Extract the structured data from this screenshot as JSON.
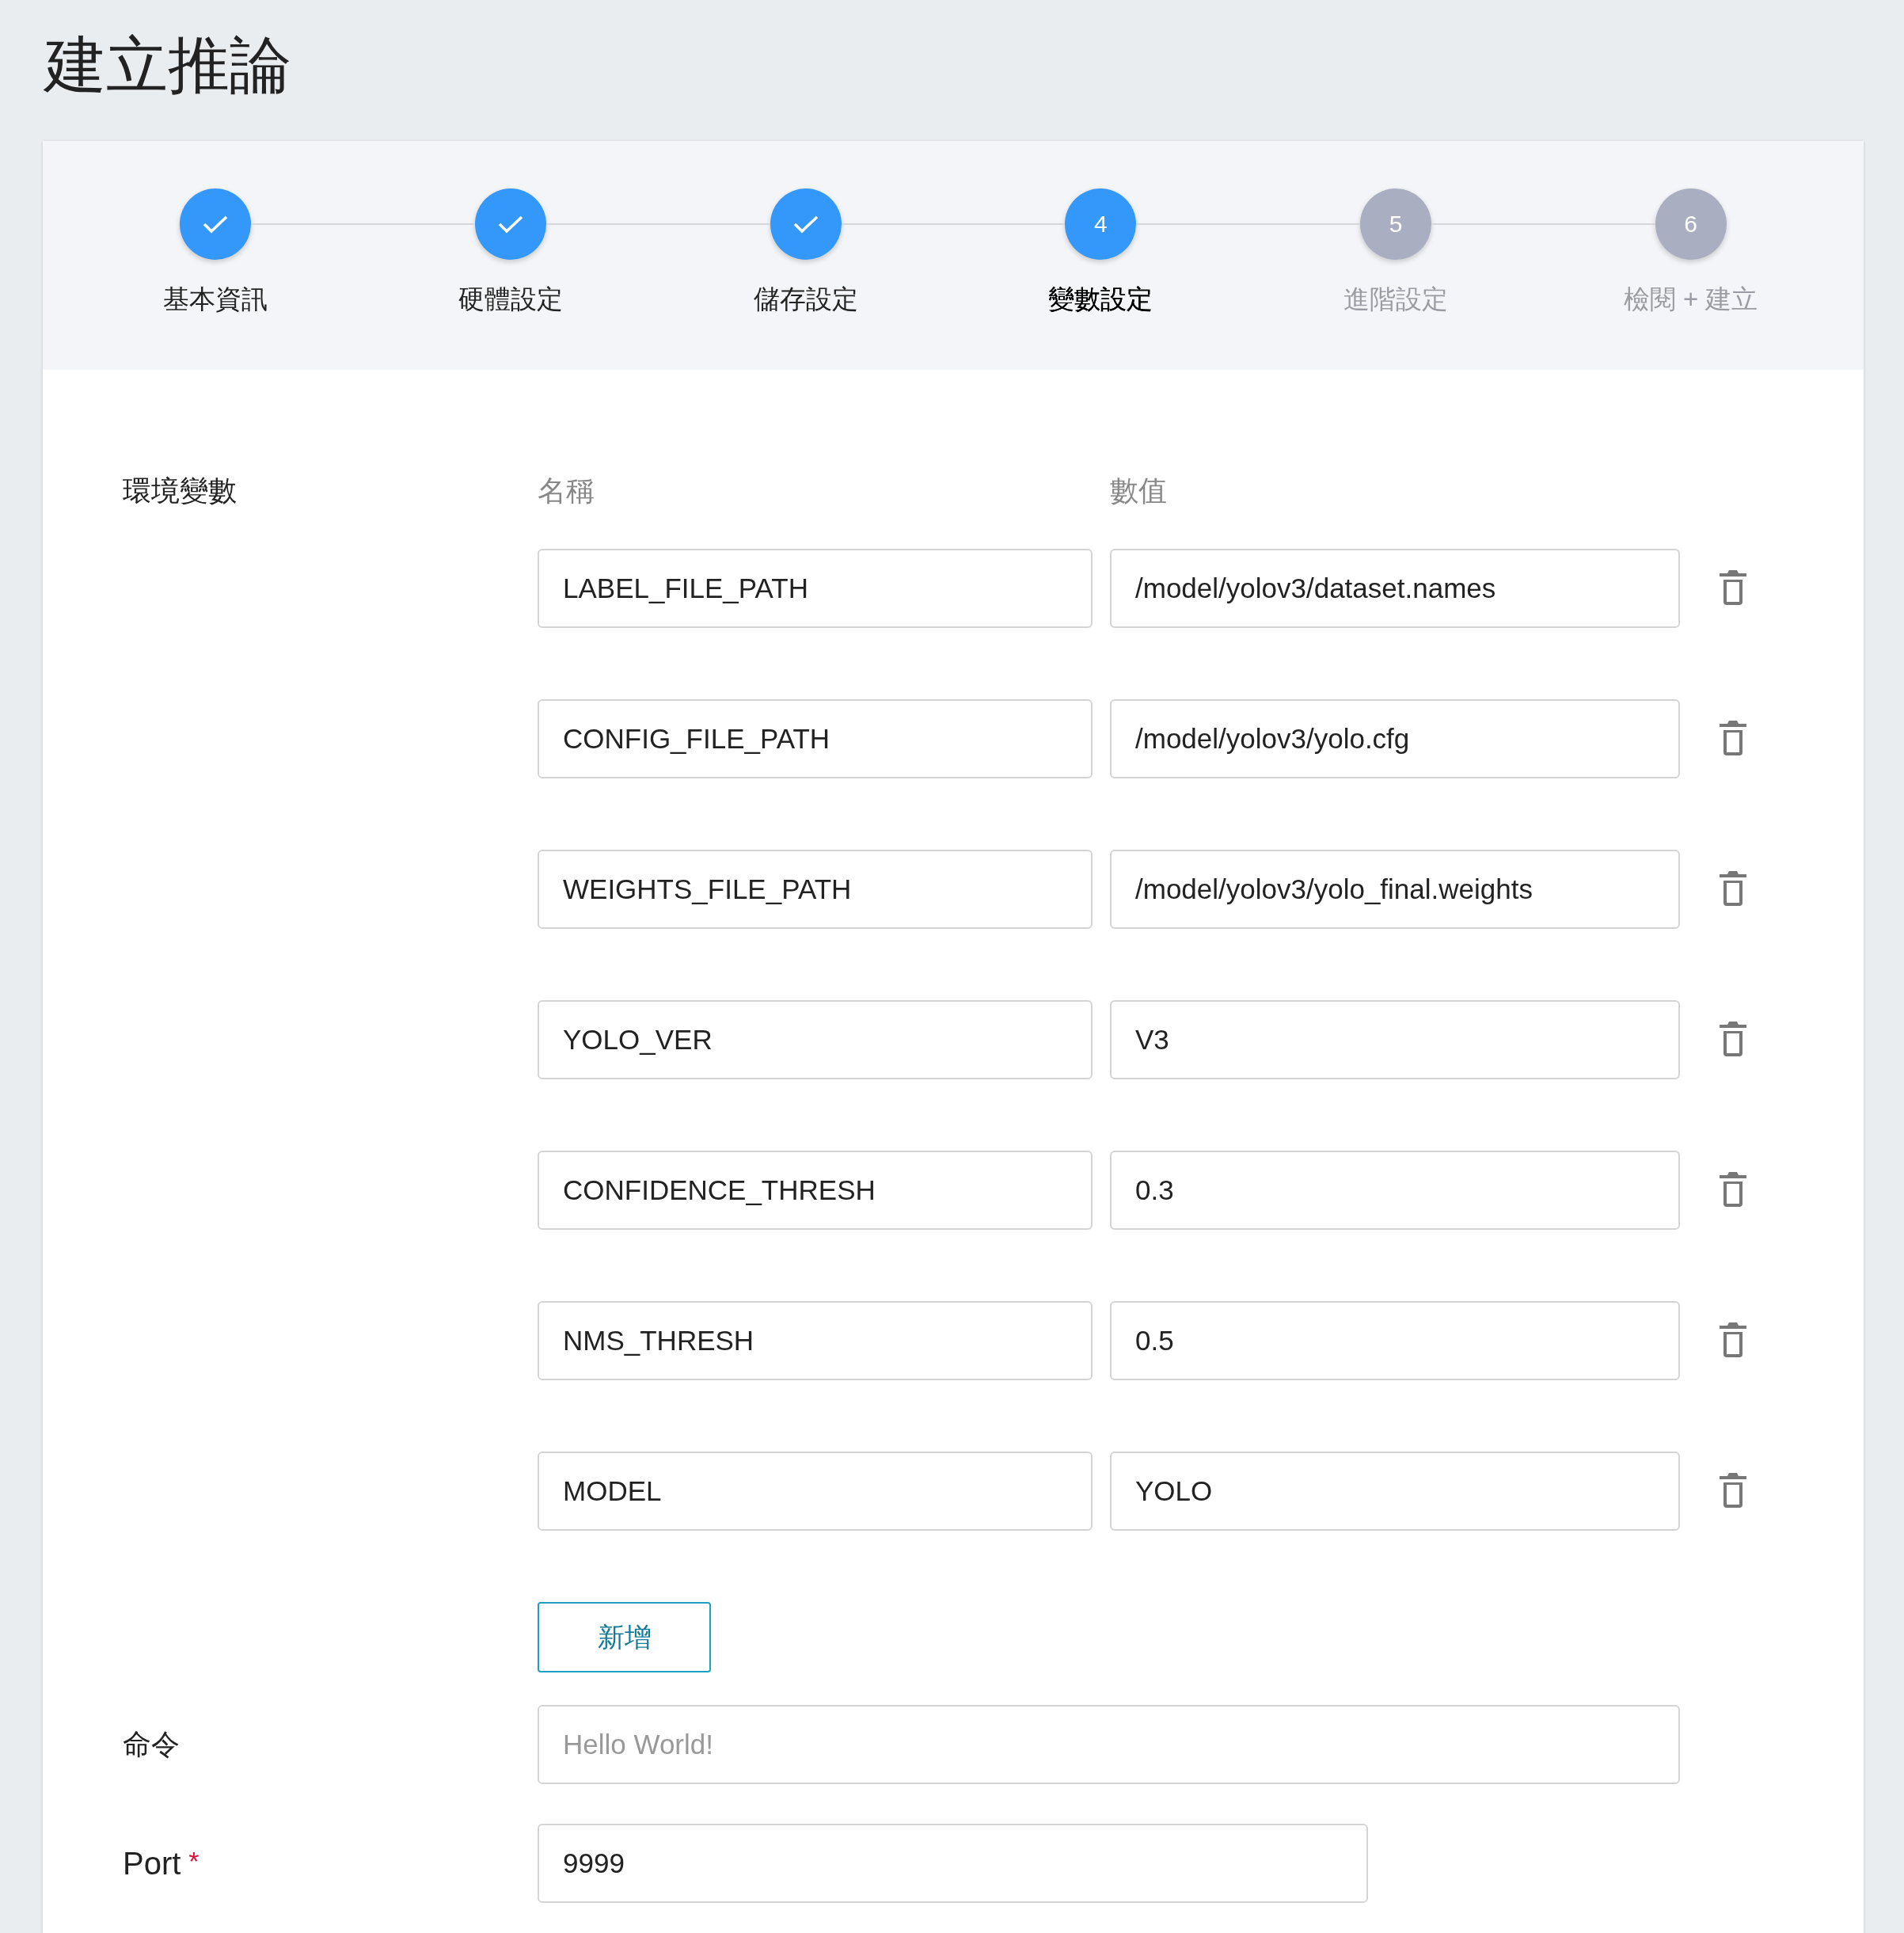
{
  "page_title": "建立推論",
  "steps": [
    {
      "label": "基本資訊",
      "completed": true,
      "selected": false
    },
    {
      "label": "硬體設定",
      "completed": true,
      "selected": false
    },
    {
      "label": "儲存設定",
      "completed": true,
      "selected": false
    },
    {
      "number": "4",
      "label": "變數設定",
      "completed": false,
      "selected": true
    },
    {
      "number": "5",
      "label": "進階設定",
      "completed": false,
      "selected": false
    },
    {
      "number": "6",
      "label": "檢閱 + 建立",
      "completed": false,
      "selected": false
    }
  ],
  "env_section": {
    "label": "環境變數",
    "name_header": "名稱",
    "value_header": "數值",
    "rows": [
      {
        "name": "LABEL_FILE_PATH",
        "value": "/model/yolov3/dataset.names"
      },
      {
        "name": "CONFIG_FILE_PATH",
        "value": "/model/yolov3/yolo.cfg"
      },
      {
        "name": "WEIGHTS_FILE_PATH",
        "value": "/model/yolov3/yolo_final.weights"
      },
      {
        "name": "YOLO_VER",
        "value": "V3"
      },
      {
        "name": "CONFIDENCE_THRESH",
        "value": "0.3"
      },
      {
        "name": "NMS_THRESH",
        "value": "0.5"
      },
      {
        "name": "MODEL",
        "value": "YOLO"
      }
    ],
    "add_button": "新增"
  },
  "command": {
    "label": "命令",
    "placeholder": "Hello World!"
  },
  "port": {
    "label": "Port",
    "required_mark": "*",
    "value": "9999"
  }
}
